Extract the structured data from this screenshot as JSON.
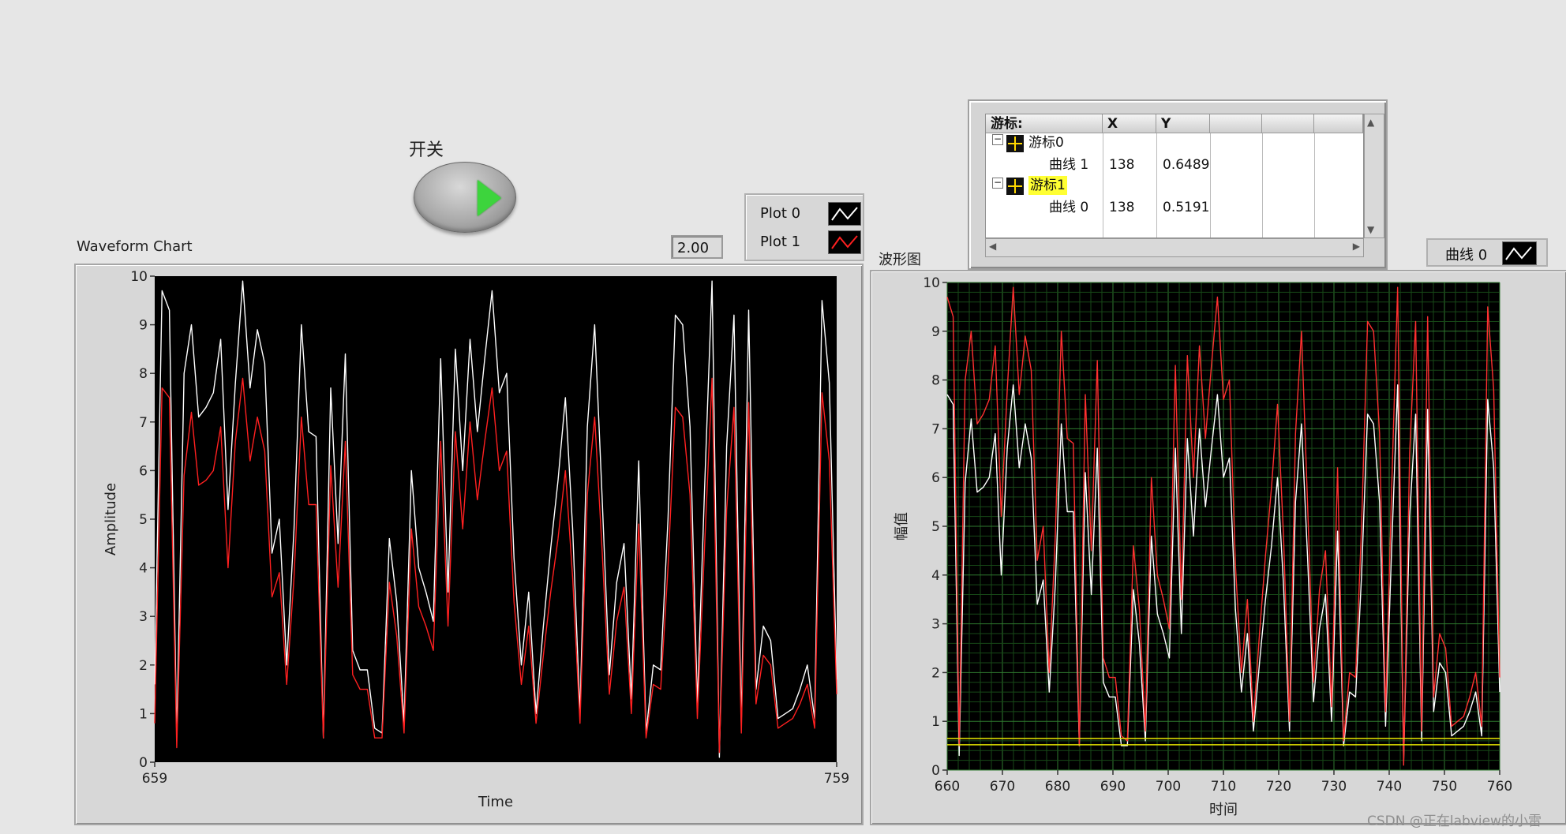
{
  "switch": {
    "label": "开关"
  },
  "numeric": {
    "value": "2.00"
  },
  "left_chart": {
    "title": "Waveform Chart",
    "xlabel": "Time",
    "ylabel": "Amplitude",
    "legend": [
      {
        "name": "Plot 0",
        "color": "#ffffff"
      },
      {
        "name": "Plot 1",
        "color": "#ff2020"
      }
    ]
  },
  "right_graph": {
    "title": "波形图",
    "xlabel": "时间",
    "ylabel": "幅值",
    "legend": [
      {
        "name": "曲线 0",
        "color": "#ffffff"
      }
    ]
  },
  "cursor_legend": {
    "headers": [
      "游标:",
      "X",
      "Y"
    ],
    "rows": [
      {
        "cursor": "游标0",
        "plot": "曲线 1",
        "x": "138",
        "y": "0.6489"
      },
      {
        "cursor": "游标1",
        "plot": "曲线 0",
        "x": "138",
        "y": "0.5191"
      }
    ]
  },
  "watermark": "CSDN @正在labview的小雷",
  "chart_data": [
    {
      "type": "line",
      "title": "Waveform Chart",
      "xlabel": "Time",
      "ylabel": "Amplitude",
      "xlim": [
        659,
        759
      ],
      "ylim": [
        0,
        10
      ],
      "x_ticks": [
        659,
        759
      ],
      "y_ticks": [
        0,
        1,
        2,
        3,
        4,
        5,
        6,
        7,
        8,
        9,
        10
      ],
      "grid": false,
      "background": "#000000",
      "series": [
        {
          "name": "Plot 0",
          "color": "#ffffff",
          "values": [
            1.6,
            9.7,
            9.3,
            0.5,
            8.0,
            9.0,
            7.1,
            7.3,
            7.6,
            8.7,
            5.2,
            7.8,
            9.9,
            7.7,
            8.9,
            8.2,
            4.3,
            5.0,
            2.0,
            4.8,
            9.0,
            6.8,
            6.7,
            0.5,
            7.7,
            4.5,
            8.4,
            2.3,
            1.9,
            1.9,
            0.7,
            0.6,
            4.6,
            3.3,
            0.8,
            6.0,
            4.0,
            3.5,
            2.9,
            8.3,
            3.5,
            8.5,
            6.0,
            8.7,
            6.8,
            8.3,
            9.7,
            7.6,
            8.0,
            4.2,
            2.0,
            3.5,
            1.0,
            2.8,
            4.4,
            5.8,
            7.5,
            4.8,
            1.0,
            6.9,
            9.0,
            5.5,
            1.8,
            3.7,
            4.5,
            1.3,
            6.2,
            0.6,
            2.0,
            1.9,
            5.0,
            9.2,
            9.0,
            6.9,
            1.2,
            5.7,
            9.9,
            0.1,
            6.5,
            9.2,
            0.8,
            9.3,
            1.5,
            2.8,
            2.5,
            0.9,
            1.0,
            1.1,
            1.5,
            2.0,
            0.9,
            9.5,
            7.8,
            1.7
          ]
        },
        {
          "name": "Plot 1",
          "color": "#ff2020",
          "values": [
            0.8,
            7.7,
            7.5,
            0.3,
            5.9,
            7.2,
            5.7,
            5.8,
            6.0,
            6.9,
            4.0,
            6.6,
            7.9,
            6.2,
            7.1,
            6.4,
            3.4,
            3.9,
            1.6,
            3.8,
            7.1,
            5.3,
            5.3,
            0.5,
            6.1,
            3.6,
            6.6,
            1.8,
            1.5,
            1.5,
            0.5,
            0.5,
            3.7,
            2.6,
            0.6,
            4.8,
            3.2,
            2.8,
            2.3,
            6.6,
            2.8,
            6.8,
            4.8,
            7.0,
            5.4,
            6.6,
            7.7,
            6.0,
            6.4,
            3.3,
            1.6,
            2.8,
            0.8,
            2.2,
            3.5,
            4.6,
            6.0,
            3.8,
            0.8,
            5.5,
            7.1,
            4.4,
            1.4,
            2.9,
            3.6,
            1.0,
            4.9,
            0.5,
            1.6,
            1.5,
            4.0,
            7.3,
            7.1,
            5.5,
            0.9,
            4.5,
            7.9,
            0.2,
            5.2,
            7.3,
            0.6,
            7.4,
            1.2,
            2.2,
            2.0,
            0.7,
            0.8,
            0.9,
            1.2,
            1.6,
            0.7,
            7.6,
            6.2,
            1.4
          ]
        }
      ]
    },
    {
      "type": "line",
      "title": "波形图",
      "xlabel": "时间",
      "ylabel": "幅值",
      "xlim": [
        660,
        760
      ],
      "ylim": [
        0,
        10
      ],
      "x_ticks": [
        660,
        670,
        680,
        690,
        700,
        710,
        720,
        730,
        740,
        750,
        760
      ],
      "y_ticks": [
        0,
        1,
        2,
        3,
        4,
        5,
        6,
        7,
        8,
        9,
        10
      ],
      "grid": true,
      "background": "#000000",
      "series": [
        {
          "name": "曲线 0",
          "color": "#ffffff",
          "values": [
            7.7,
            7.5,
            0.3,
            5.9,
            7.2,
            5.7,
            5.8,
            6.0,
            6.9,
            4.0,
            6.6,
            7.9,
            6.2,
            7.1,
            6.4,
            3.4,
            3.9,
            1.6,
            3.8,
            7.1,
            5.3,
            5.3,
            0.5,
            6.1,
            3.6,
            6.6,
            1.8,
            1.5,
            1.5,
            0.5,
            0.5,
            3.7,
            2.6,
            0.6,
            4.8,
            3.2,
            2.8,
            2.3,
            6.6,
            2.8,
            6.8,
            4.8,
            7.0,
            5.4,
            6.6,
            7.7,
            6.0,
            6.4,
            3.3,
            1.6,
            2.8,
            0.8,
            2.2,
            3.5,
            4.6,
            6.0,
            3.8,
            0.8,
            5.5,
            7.1,
            4.4,
            1.4,
            2.9,
            3.6,
            1.0,
            4.9,
            0.5,
            1.6,
            1.5,
            4.0,
            7.3,
            7.1,
            5.5,
            0.9,
            4.5,
            7.9,
            0.2,
            5.2,
            7.3,
            0.6,
            7.4,
            1.2,
            2.2,
            2.0,
            0.7,
            0.8,
            0.9,
            1.2,
            1.6,
            0.7,
            7.6,
            6.2,
            1.6
          ]
        },
        {
          "name": "",
          "color": "#ff3030",
          "values": [
            9.7,
            9.3,
            0.5,
            8.0,
            9.0,
            7.1,
            7.3,
            7.6,
            8.7,
            5.2,
            7.8,
            9.9,
            7.7,
            8.9,
            8.2,
            4.3,
            5.0,
            2.0,
            4.8,
            9.0,
            6.8,
            6.7,
            0.5,
            7.7,
            4.5,
            8.4,
            2.3,
            1.9,
            1.9,
            0.7,
            0.6,
            4.6,
            3.3,
            0.8,
            6.0,
            4.0,
            3.5,
            2.9,
            8.3,
            3.5,
            8.5,
            6.0,
            8.7,
            6.8,
            8.3,
            9.7,
            7.6,
            8.0,
            4.2,
            2.0,
            3.5,
            1.0,
            2.8,
            4.4,
            5.8,
            7.5,
            4.8,
            1.0,
            6.9,
            9.0,
            5.5,
            1.8,
            3.7,
            4.5,
            1.3,
            6.2,
            0.6,
            2.0,
            1.9,
            5.0,
            9.2,
            9.0,
            6.9,
            1.2,
            5.7,
            9.9,
            0.1,
            6.5,
            9.2,
            0.8,
            9.3,
            1.5,
            2.8,
            2.5,
            0.9,
            1.0,
            1.1,
            1.5,
            2.0,
            0.9,
            9.5,
            7.8,
            1.9
          ]
        }
      ],
      "cursors": [
        {
          "name": "游标0",
          "y": 0.6489,
          "color": "#e6e600"
        },
        {
          "name": "游标1",
          "y": 0.5191,
          "color": "#e6e600"
        }
      ]
    }
  ]
}
